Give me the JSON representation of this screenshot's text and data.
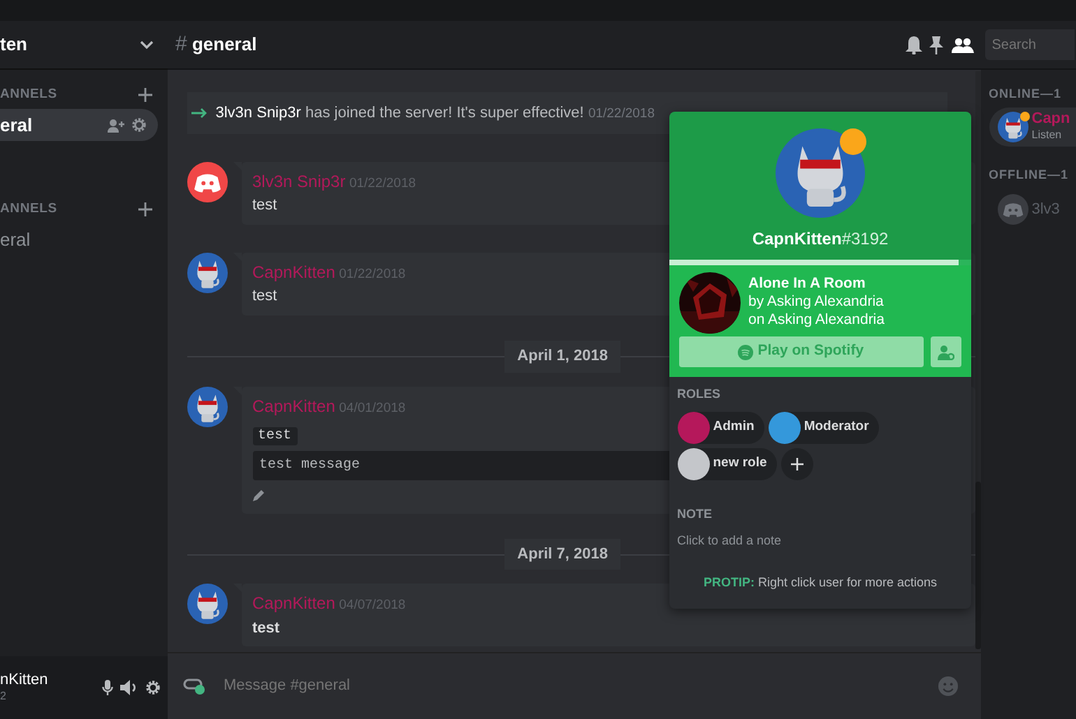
{
  "server": {
    "name": "ten"
  },
  "channel_groups": [
    {
      "label": "ANNELS",
      "channels": [
        {
          "name": "eral",
          "selected": true
        }
      ]
    },
    {
      "label": "ANNELS",
      "channels": [
        {
          "name": "eral",
          "selected": false
        }
      ]
    }
  ],
  "user_panel": {
    "name": "nKitten",
    "tag": "2"
  },
  "channel_header": {
    "hash": "#",
    "name": "general"
  },
  "search": {
    "placeholder": "Search"
  },
  "messages": [
    {
      "kind": "join",
      "user": "3lv3n Snip3r",
      "text": "has joined the server! It's super effective!",
      "time": "01/22/2018"
    },
    {
      "kind": "message",
      "avatar": {
        "kind": "discord"
      },
      "author": "3lv3n Snip3r",
      "time": "01/22/2018",
      "lines": [
        {
          "kind": "text",
          "text": "test"
        }
      ]
    },
    {
      "kind": "message",
      "avatar": {
        "kind": "kitten"
      },
      "author": "CapnKitten",
      "time": "01/22/2018",
      "lines": [
        {
          "kind": "text",
          "text": "test"
        }
      ]
    },
    {
      "kind": "divider",
      "label": "April 1, 2018"
    },
    {
      "kind": "message",
      "avatar": {
        "kind": "kitten"
      },
      "author": "CapnKitten",
      "time": "04/01/2018",
      "lines": [
        {
          "kind": "inline_code",
          "text": "test"
        },
        {
          "kind": "code_block",
          "text": "test message"
        },
        {
          "kind": "edit"
        }
      ]
    },
    {
      "kind": "divider",
      "label": "April 7, 2018"
    },
    {
      "kind": "message",
      "avatar": {
        "kind": "kitten"
      },
      "author": "CapnKitten",
      "time": "04/07/2018",
      "lines": [
        {
          "kind": "bold",
          "text": "test"
        }
      ]
    }
  ],
  "composer": {
    "placeholder": "Message #general"
  },
  "members": [
    {
      "label": "ONLINE—1",
      "members": [
        {
          "name": "Capn",
          "activity": "Listen",
          "avatar": {
            "kind": "kitten"
          },
          "status_dot": {
            "color": "#faa61a"
          },
          "offline": false
        }
      ]
    },
    {
      "label": "OFFLINE—1",
      "members": [
        {
          "name": "3lv3",
          "avatar": {
            "kind": "discord"
          },
          "offline": true
        }
      ]
    }
  ],
  "profile_popout": {
    "username": "CapnKitten",
    "discriminator": "#3192",
    "status_dot": {
      "color": "#faa61a"
    },
    "progress": {
      "level": 0.96
    },
    "song": {
      "title": "Alone In A Room",
      "artist": "by Asking Alexandria",
      "album": "on Asking Alexandria"
    },
    "play_button": "Play on Spotify",
    "roles_label": "ROLES",
    "roles": [
      {
        "name": "Admin",
        "color": "#b5185b"
      },
      {
        "name": "Moderator",
        "color": "#3498db"
      },
      {
        "name": "new role",
        "color": "#c4c6ca"
      }
    ],
    "note_label": "NOTE",
    "note_placeholder": "Click to add a note",
    "protip": {
      "label": "PROTIP:",
      "text": "Right click user for more actions"
    }
  }
}
